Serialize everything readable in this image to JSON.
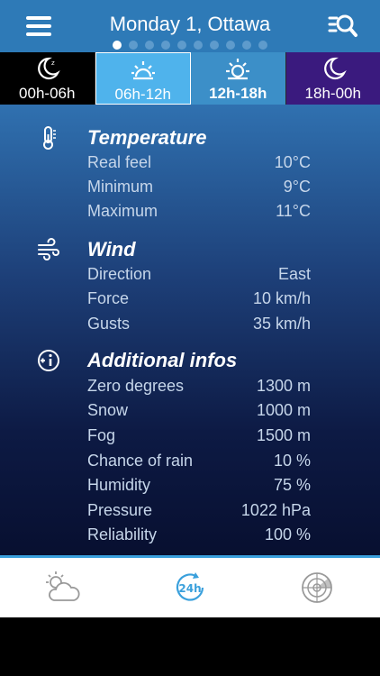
{
  "header": {
    "title": "Monday 1, Ottawa",
    "page_count": 10,
    "active_page": 0
  },
  "tabs": [
    {
      "label": "00h-06h",
      "icon": "moon-icon"
    },
    {
      "label": "06h-12h",
      "icon": "sun-icon"
    },
    {
      "label": "12h-18h",
      "icon": "sun-icon"
    },
    {
      "label": "18h-00h",
      "icon": "moon-icon"
    }
  ],
  "temperature": {
    "title": "Temperature",
    "icon": "thermometer-icon",
    "rows": [
      {
        "label": "Real feel",
        "value": "10°C"
      },
      {
        "label": "Minimum",
        "value": "9°C"
      },
      {
        "label": "Maximum",
        "value": "11°C"
      }
    ]
  },
  "wind": {
    "title": "Wind",
    "icon": "wind-icon",
    "rows": [
      {
        "label": "Direction",
        "value": "East"
      },
      {
        "label": "Force",
        "value": "10 km/h"
      },
      {
        "label": "Gusts",
        "value": "35 km/h"
      }
    ]
  },
  "additional": {
    "title": "Additional infos",
    "icon": "info-icon",
    "rows": [
      {
        "label": "Zero degrees",
        "value": "1300 m"
      },
      {
        "label": "Snow",
        "value": "1000 m"
      },
      {
        "label": "Fog",
        "value": "1500 m"
      },
      {
        "label": "Chance of rain",
        "value": "10 %"
      },
      {
        "label": "Humidity",
        "value": "75 %"
      },
      {
        "label": "Pressure",
        "value": "1022 hPa"
      },
      {
        "label": "Reliability",
        "value": "100 %"
      }
    ]
  },
  "bottom_nav": [
    {
      "icon": "weather-cloud-sun-icon"
    },
    {
      "icon": "24h-forecast-icon"
    },
    {
      "icon": "radar-icon"
    }
  ],
  "colors": {
    "header": "#2e7ab7",
    "tab_selected_bg": "#4fb3ec",
    "tab_night_bg": "#3a1a7e",
    "accent": "#3aa0dc"
  }
}
